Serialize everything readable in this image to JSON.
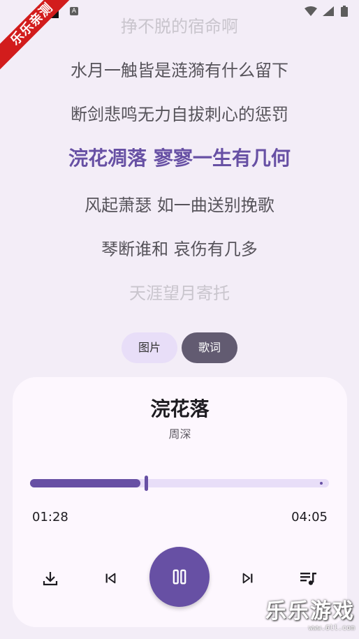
{
  "status_bar": {
    "keyboard_icon": "A"
  },
  "ribbon_text": "乐乐亲测",
  "lyrics": [
    {
      "text": "挣不脱的宿命啊",
      "state": "faint"
    },
    {
      "text": "水月一触皆是涟漪有什么留下",
      "state": "normal"
    },
    {
      "text": "断剑悲鸣无力自拔刺心的惩罚",
      "state": "normal"
    },
    {
      "text": "浣花凋落 寥寥一生有几何",
      "state": "active"
    },
    {
      "text": "风起萧瑟 如一曲送别挽歌",
      "state": "normal"
    },
    {
      "text": "琴断谁和 哀伤有几多",
      "state": "normal"
    },
    {
      "text": "天涯望月寄托",
      "state": "faint"
    }
  ],
  "toggle": {
    "image_label": "图片",
    "lyrics_label": "歌词",
    "selected": "lyrics"
  },
  "player": {
    "title": "浣花落",
    "artist": "周深",
    "current_time": "01:28",
    "total_time": "04:05",
    "progress": 0.37
  },
  "controls": [
    "download-icon",
    "skip-previous-icon",
    "pause-icon",
    "skip-next-icon",
    "playlist-icon"
  ],
  "colors": {
    "accent": "#6750a4",
    "background": "#f3edf7",
    "card": "#fdf7fe"
  },
  "watermark": {
    "main": "乐乐游戏",
    "sub": "www.6ll.com"
  }
}
